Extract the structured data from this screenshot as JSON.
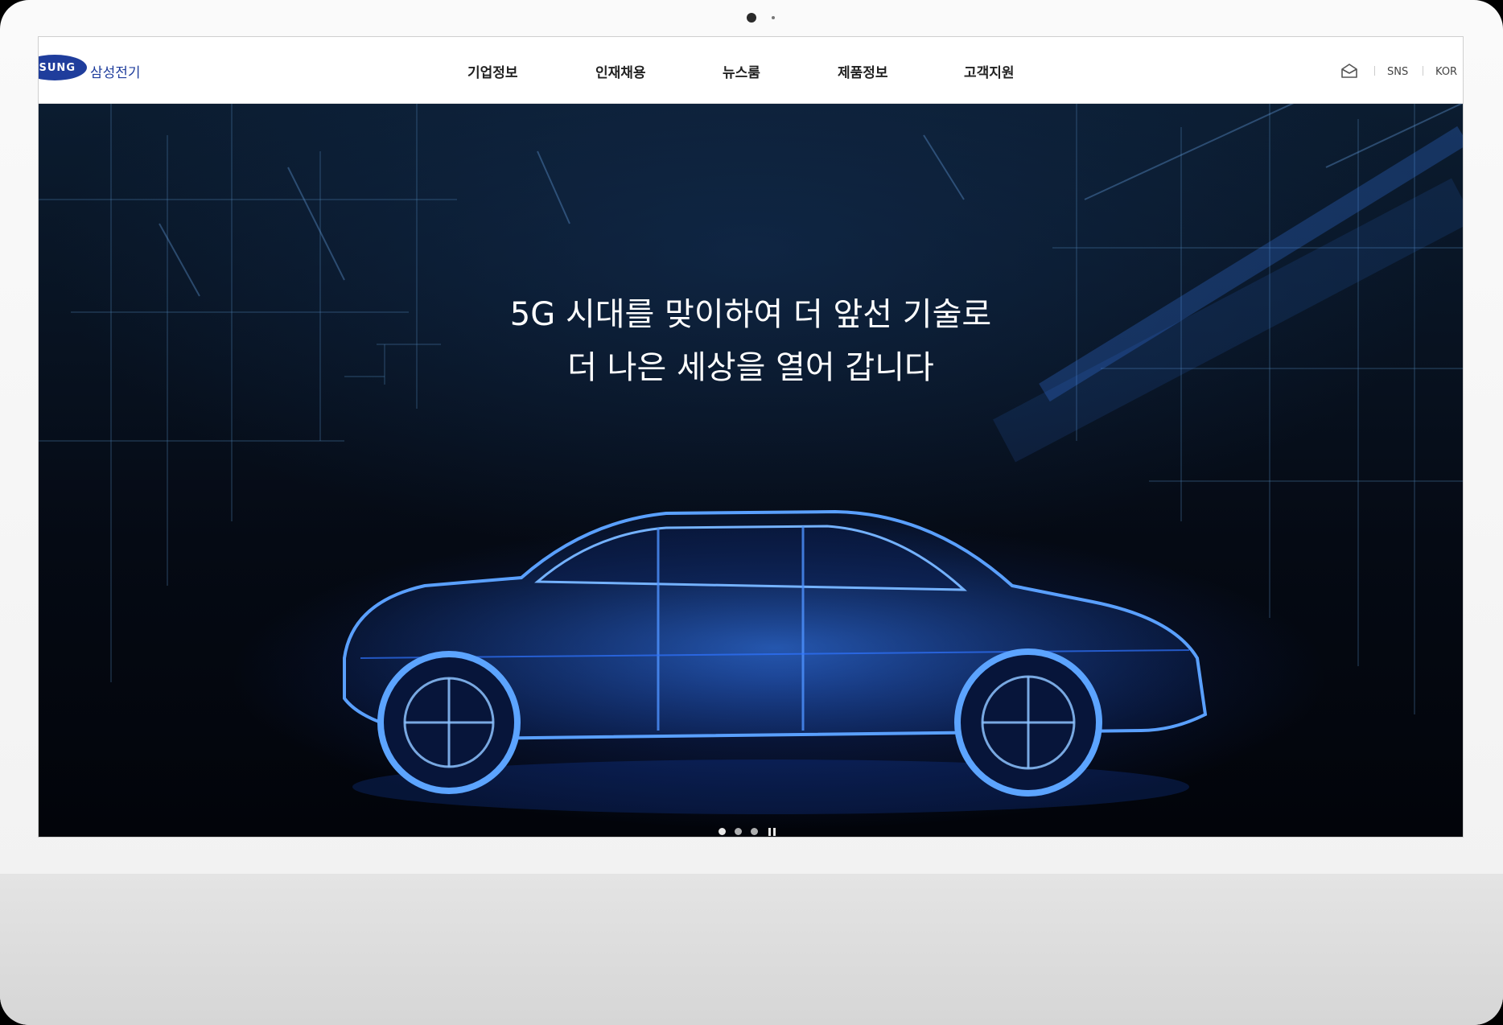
{
  "brand": {
    "logo_mark": "SUNG",
    "name": "삼성전기",
    "color": "#1f3d9c"
  },
  "nav": {
    "items": [
      {
        "label": "기업정보"
      },
      {
        "label": "인재채용"
      },
      {
        "label": "뉴스룸"
      },
      {
        "label": "제품정보"
      },
      {
        "label": "고객지원"
      }
    ]
  },
  "utility": {
    "icon": "mail-icon",
    "sns_label": "SNS",
    "lang_label": "KOR"
  },
  "hero": {
    "headline_line1": "5G 시대를 맞이하여 더 앞선 기술로",
    "headline_line2": "더 나은 세상을 열어 갑니다",
    "accent_color": "#1e6bff",
    "slide_count": 3,
    "active_slide": 1,
    "pause_icon": "pause-icon"
  }
}
